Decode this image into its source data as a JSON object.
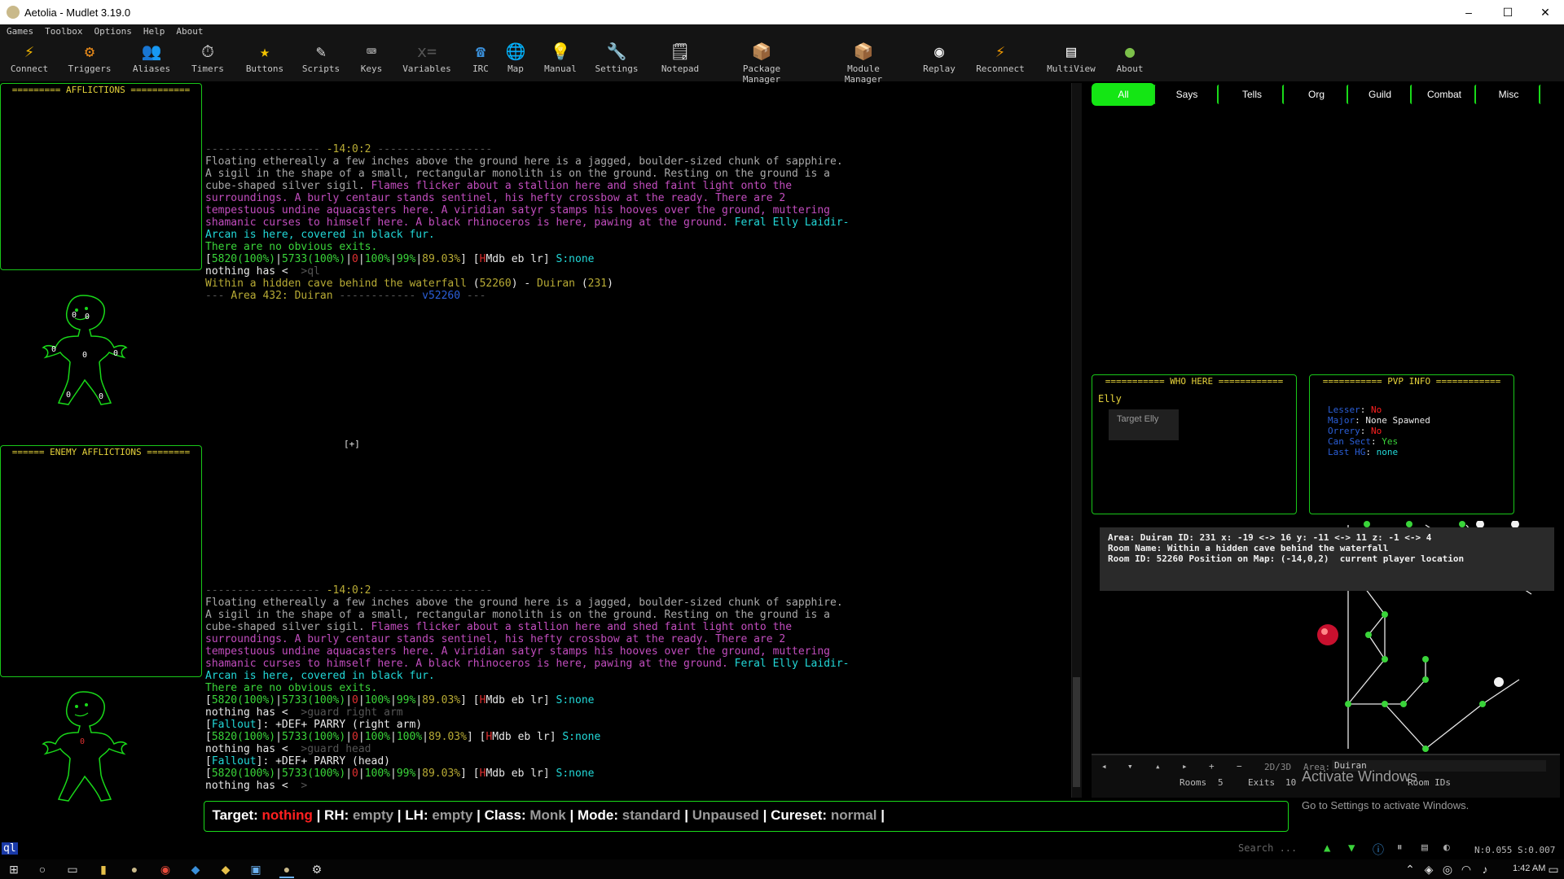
{
  "window": {
    "title": "Aetolia - Mudlet 3.19.0",
    "controls": [
      "–",
      "☐",
      "✕"
    ]
  },
  "menu": [
    "Games",
    "Toolbox",
    "Options",
    "Help",
    "About"
  ],
  "toolbar": [
    {
      "label": "Connect",
      "icon": "⚡",
      "color": "#f2b600"
    },
    {
      "label": "Triggers",
      "icon": "⚙",
      "color": "#e88a1a"
    },
    {
      "label": "Aliases",
      "icon": "👥",
      "color": "#dddddd"
    },
    {
      "label": "Timers",
      "icon": "⏱",
      "color": "#dddddd"
    },
    {
      "label": "Buttons",
      "icon": "★",
      "color": "#f2c200"
    },
    {
      "label": "Scripts",
      "icon": "✎",
      "color": "#dddddd"
    },
    {
      "label": "Keys",
      "icon": "⌨",
      "color": "#dddddd"
    },
    {
      "label": "Variables",
      "icon": "x=",
      "color": "#555555"
    },
    {
      "label": "IRC",
      "icon": "☎",
      "color": "#3a8fd9"
    },
    {
      "label": "Map",
      "icon": "🌐",
      "color": "#3a8fd9"
    },
    {
      "label": "Manual",
      "icon": "💡",
      "color": "#f2c200"
    },
    {
      "label": "Settings",
      "icon": "🔧",
      "color": "#cccccc"
    },
    {
      "label": "Notepad",
      "icon": "🗒",
      "color": "#eeeeee"
    },
    {
      "label": "Package Manager",
      "icon": "📦",
      "color": "#c8964a"
    },
    {
      "label": "Module Manager",
      "icon": "📦",
      "color": "#b8864a"
    },
    {
      "label": "Replay",
      "icon": "◉",
      "color": "#eeeeee"
    },
    {
      "label": "Reconnect",
      "icon": "⚡",
      "color": "#f29a00"
    },
    {
      "label": "MultiView",
      "icon": "▤",
      "color": "#eeeeee"
    },
    {
      "label": "About",
      "icon": "●",
      "color": "#7cc04a"
    }
  ],
  "panes": {
    "afflictions": "========= AFFLICTIONS ===========",
    "enemy_afflictions": "====== ENEMY AFFLICTIONS ========",
    "who_here": "=========== WHO HERE ============",
    "pvp_info": "=========== PVP INFO ============"
  },
  "who_here": {
    "name": "Elly",
    "button": "Target Elly"
  },
  "pvp": [
    {
      "label": "Lesser",
      "value": "No",
      "color": "#ff2020"
    },
    {
      "label": "Major",
      "value": "None Spawned",
      "color": "#e8e8e8"
    },
    {
      "label": "Orrery",
      "value": "No",
      "color": "#ff2020"
    },
    {
      "label": "Can Sect",
      "value": "Yes",
      "color": "#3ad43a"
    },
    {
      "label": "Last HG",
      "value": "none",
      "color": "#22d8d8"
    }
  ],
  "body_markers": {
    "top": [
      "0",
      "0",
      "0",
      "0",
      "0",
      "0",
      "0"
    ],
    "bottom_red": "0"
  },
  "tabs": [
    "All",
    "Says",
    "Tells",
    "Org",
    "Guild",
    "Combat",
    "Misc"
  ],
  "main": {
    "block1": {
      "dashes_left": "------------------ ",
      "coords": "-14:0:2",
      "dashes_right": " ------------------",
      "room_desc": [
        [
          {
            "t": "Floating ethereally a few inches above the ground here is a jagged, boulder-sized chunk of sapphire.",
            "c": "g"
          }
        ],
        [
          {
            "t": "A sigil in the shape of a small, rectangular monolith is on the ground. Resting on the ground is a",
            "c": "g"
          }
        ],
        [
          {
            "t": "cube-shaped silver sigil. ",
            "c": "g"
          },
          {
            "t": "Flames flicker about a stallion here and shed faint light onto the",
            "c": "m"
          }
        ],
        [
          {
            "t": "surroundings. A burly centaur stands sentinel, his hefty crossbow at the ready. There are 2",
            "c": "m"
          }
        ],
        [
          {
            "t": "tempestuous undine aquacasters here. A viridian satyr stamps his hooves over the ground, muttering",
            "c": "m"
          }
        ],
        [
          {
            "t": "shamanic curses to himself here. A black rhinoceros is here, pawing at the ground. ",
            "c": "m"
          },
          {
            "t": "Feral Elly Laidir-",
            "c": "c"
          }
        ],
        [
          {
            "t": "Arcan is here, covered in black fur.",
            "c": "c"
          }
        ],
        [
          {
            "t": "There are no obvious exits.",
            "c": "gr"
          }
        ]
      ],
      "prompt": [
        {
          "t": "[",
          "c": "w"
        },
        {
          "t": "5820(100%)",
          "c": "gr"
        },
        {
          "t": "|",
          "c": "w"
        },
        {
          "t": "5733(100%)",
          "c": "gr"
        },
        {
          "t": "|",
          "c": "w"
        },
        {
          "t": "0",
          "c": "r"
        },
        {
          "t": "|",
          "c": "w"
        },
        {
          "t": "100%",
          "c": "gr"
        },
        {
          "t": "|",
          "c": "w"
        },
        {
          "t": "99%",
          "c": "gr"
        },
        {
          "t": "|",
          "c": "w"
        },
        {
          "t": "89.03%",
          "c": "y"
        },
        {
          "t": "] [",
          "c": "w"
        },
        {
          "t": "H",
          "c": "r"
        },
        {
          "t": "Mdb eb lr] ",
          "c": "w"
        },
        {
          "t": "S:none",
          "c": "c"
        }
      ],
      "cmd": [
        {
          "t": "nothing has < ",
          "c": "w"
        },
        {
          "t": " >ql",
          "c": "dg"
        }
      ],
      "location": [
        {
          "t": "Within a hidden cave behind the waterfall ",
          "c": "y"
        },
        {
          "t": "(",
          "c": "w"
        },
        {
          "t": "52260",
          "c": "y"
        },
        {
          "t": ") - ",
          "c": "w"
        },
        {
          "t": "Duiran ",
          "c": "y"
        },
        {
          "t": "(",
          "c": "w"
        },
        {
          "t": "231",
          "c": "y"
        },
        {
          "t": ")",
          "c": "w"
        }
      ],
      "area": [
        {
          "t": "--- ",
          "c": "dg"
        },
        {
          "t": "Area 432: Duiran",
          "c": "y"
        },
        {
          "t": " ------------ ",
          "c": "dg"
        },
        {
          "t": "v52260",
          "c": "bl"
        },
        {
          "t": " ---",
          "c": "dg"
        }
      ]
    },
    "cursor": "[+]",
    "block2_extra": [
      [
        {
          "t": "nothing has < ",
          "c": "w"
        },
        {
          "t": " >guard right arm",
          "c": "dg"
        }
      ],
      [
        {
          "t": "[",
          "c": "w"
        },
        {
          "t": "Fallout",
          "c": "c"
        },
        {
          "t": "]: +DEF+ PARRY (right arm)",
          "c": "w"
        }
      ],
      [
        {
          "t": "[",
          "c": "w"
        },
        {
          "t": "5820(100%)",
          "c": "gr"
        },
        {
          "t": "|",
          "c": "w"
        },
        {
          "t": "5733(100%)",
          "c": "gr"
        },
        {
          "t": "|",
          "c": "w"
        },
        {
          "t": "0",
          "c": "r"
        },
        {
          "t": "|",
          "c": "w"
        },
        {
          "t": "100%",
          "c": "gr"
        },
        {
          "t": "|",
          "c": "w"
        },
        {
          "t": "100%",
          "c": "gr"
        },
        {
          "t": "|",
          "c": "w"
        },
        {
          "t": "89.03%",
          "c": "y"
        },
        {
          "t": "] [",
          "c": "w"
        },
        {
          "t": "H",
          "c": "r"
        },
        {
          "t": "Mdb eb lr] ",
          "c": "w"
        },
        {
          "t": "S:none",
          "c": "c"
        }
      ],
      [
        {
          "t": "nothing has < ",
          "c": "w"
        },
        {
          "t": " >guard head",
          "c": "dg"
        }
      ],
      [
        {
          "t": "[",
          "c": "w"
        },
        {
          "t": "Fallout",
          "c": "c"
        },
        {
          "t": "]: +DEF+ PARRY (head)",
          "c": "w"
        }
      ],
      [
        {
          "t": "[",
          "c": "w"
        },
        {
          "t": "5820(100%)",
          "c": "gr"
        },
        {
          "t": "|",
          "c": "w"
        },
        {
          "t": "5733(100%)",
          "c": "gr"
        },
        {
          "t": "|",
          "c": "w"
        },
        {
          "t": "0",
          "c": "r"
        },
        {
          "t": "|",
          "c": "w"
        },
        {
          "t": "100%",
          "c": "gr"
        },
        {
          "t": "|",
          "c": "w"
        },
        {
          "t": "99%",
          "c": "gr"
        },
        {
          "t": "|",
          "c": "w"
        },
        {
          "t": "89.03%",
          "c": "y"
        },
        {
          "t": "] [",
          "c": "w"
        },
        {
          "t": "H",
          "c": "r"
        },
        {
          "t": "Mdb eb lr] ",
          "c": "w"
        },
        {
          "t": "S:none",
          "c": "c"
        }
      ],
      [
        {
          "t": "nothing has < ",
          "c": "w"
        },
        {
          "t": " > ",
          "c": "dg"
        }
      ]
    ]
  },
  "status": [
    {
      "k": "Target: ",
      "v": "nothing",
      "vc": "red"
    },
    {
      "k": "RH: ",
      "v": "empty",
      "vc": "val"
    },
    {
      "k": "LH: ",
      "v": "empty",
      "vc": "val"
    },
    {
      "k": "Class: ",
      "v": "Monk",
      "vc": "val"
    },
    {
      "k": "Mode: ",
      "v": "standard",
      "vc": "val"
    },
    {
      "k": "",
      "v": "Unpaused",
      "vc": "val"
    },
    {
      "k": "Cureset: ",
      "v": "normal",
      "vc": "val"
    }
  ],
  "map": {
    "info": "Area: Duiran ID: 231 x: -19 <-> 16 y: -11 <-> 11 z: -1 <-> 4\nRoom Name: Within a hidden cave behind the waterfall\nRoom ID: 52260 Position on Map: (-14,0,2)  current player location",
    "controls": {
      "mode": "2D/3D",
      "area_label": "Area:",
      "area_value": "Duiran",
      "rooms_label": "Rooms",
      "rooms_value": "5",
      "exits_label": "Exits",
      "exits_value": "10",
      "room_ids": "Room IDs",
      "arrows": [
        "◂",
        "▾",
        "▴",
        "▸",
        "+",
        "−"
      ]
    },
    "activate_title": "Activate Windows",
    "activate_sub": "Go to Settings to activate Windows."
  },
  "input": {
    "command": "ql",
    "search_placeholder": "Search ...",
    "net": "N:0.055 S:0.007"
  },
  "taskbar": {
    "time": "1:42 AM"
  }
}
